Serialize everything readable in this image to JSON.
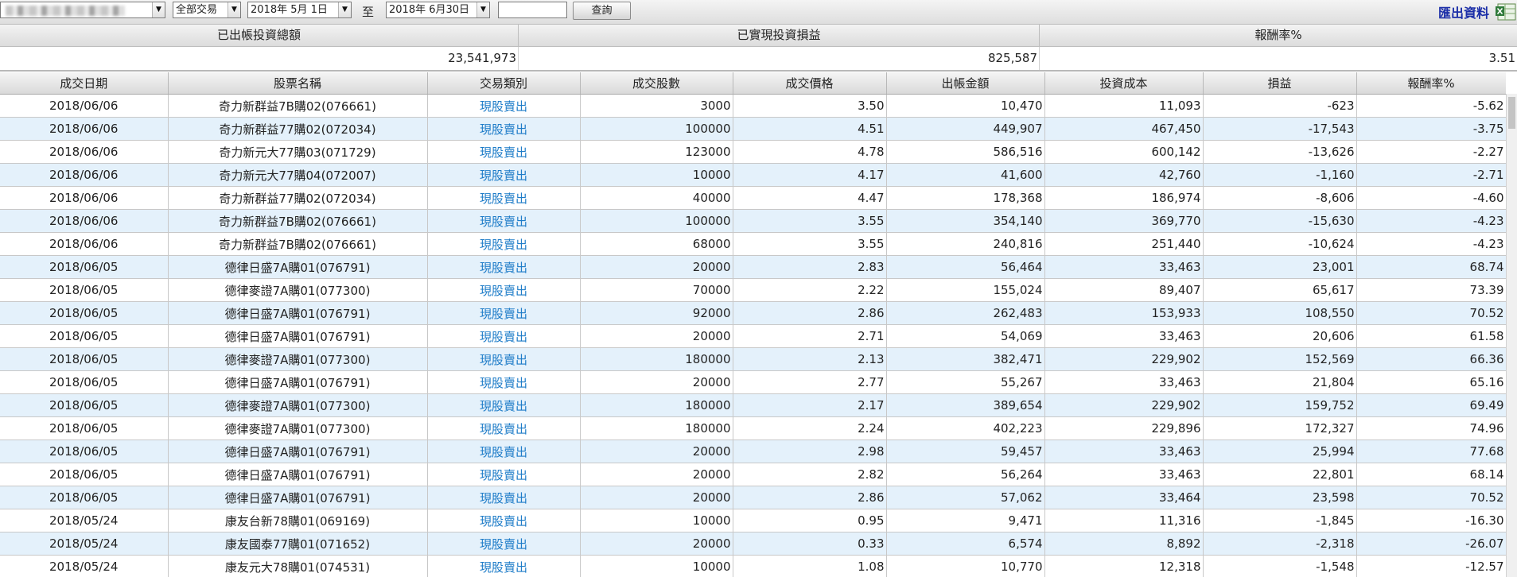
{
  "toolbar": {
    "account_select_value": "",
    "type_select_value": "全部交易",
    "date_from": "2018年 5月 1日",
    "to_label": "至",
    "date_to": "2018年 6月30日",
    "keyword_value": "",
    "query_label": "查詢",
    "export_label": "匯出資料",
    "export_icon": "excel-icon"
  },
  "summary": {
    "headers": [
      "已出帳投資總額",
      "已實現投資損益",
      "報酬率%"
    ],
    "values": [
      "23,541,973",
      "825,587",
      "3.51"
    ]
  },
  "table": {
    "columns": [
      "成交日期",
      "股票名稱",
      "交易類別",
      "成交股數",
      "成交價格",
      "出帳金額",
      "投資成本",
      "損益",
      "報酬率%"
    ],
    "rows": [
      [
        "2018/06/06",
        "奇力新群益7B購02(076661)",
        "現股賣出",
        "3000",
        "3.50",
        "10,470",
        "11,093",
        "-623",
        "-5.62"
      ],
      [
        "2018/06/06",
        "奇力新群益77購02(072034)",
        "現股賣出",
        "100000",
        "4.51",
        "449,907",
        "467,450",
        "-17,543",
        "-3.75"
      ],
      [
        "2018/06/06",
        "奇力新元大77購03(071729)",
        "現股賣出",
        "123000",
        "4.78",
        "586,516",
        "600,142",
        "-13,626",
        "-2.27"
      ],
      [
        "2018/06/06",
        "奇力新元大77購04(072007)",
        "現股賣出",
        "10000",
        "4.17",
        "41,600",
        "42,760",
        "-1,160",
        "-2.71"
      ],
      [
        "2018/06/06",
        "奇力新群益77購02(072034)",
        "現股賣出",
        "40000",
        "4.47",
        "178,368",
        "186,974",
        "-8,606",
        "-4.60"
      ],
      [
        "2018/06/06",
        "奇力新群益7B購02(076661)",
        "現股賣出",
        "100000",
        "3.55",
        "354,140",
        "369,770",
        "-15,630",
        "-4.23"
      ],
      [
        "2018/06/06",
        "奇力新群益7B購02(076661)",
        "現股賣出",
        "68000",
        "3.55",
        "240,816",
        "251,440",
        "-10,624",
        "-4.23"
      ],
      [
        "2018/06/05",
        "德律日盛7A購01(076791)",
        "現股賣出",
        "20000",
        "2.83",
        "56,464",
        "33,463",
        "23,001",
        "68.74"
      ],
      [
        "2018/06/05",
        "德律麥證7A購01(077300)",
        "現股賣出",
        "70000",
        "2.22",
        "155,024",
        "89,407",
        "65,617",
        "73.39"
      ],
      [
        "2018/06/05",
        "德律日盛7A購01(076791)",
        "現股賣出",
        "92000",
        "2.86",
        "262,483",
        "153,933",
        "108,550",
        "70.52"
      ],
      [
        "2018/06/05",
        "德律日盛7A購01(076791)",
        "現股賣出",
        "20000",
        "2.71",
        "54,069",
        "33,463",
        "20,606",
        "61.58"
      ],
      [
        "2018/06/05",
        "德律麥證7A購01(077300)",
        "現股賣出",
        "180000",
        "2.13",
        "382,471",
        "229,902",
        "152,569",
        "66.36"
      ],
      [
        "2018/06/05",
        "德律日盛7A購01(076791)",
        "現股賣出",
        "20000",
        "2.77",
        "55,267",
        "33,463",
        "21,804",
        "65.16"
      ],
      [
        "2018/06/05",
        "德律麥證7A購01(077300)",
        "現股賣出",
        "180000",
        "2.17",
        "389,654",
        "229,902",
        "159,752",
        "69.49"
      ],
      [
        "2018/06/05",
        "德律麥證7A購01(077300)",
        "現股賣出",
        "180000",
        "2.24",
        "402,223",
        "229,896",
        "172,327",
        "74.96"
      ],
      [
        "2018/06/05",
        "德律日盛7A購01(076791)",
        "現股賣出",
        "20000",
        "2.98",
        "59,457",
        "33,463",
        "25,994",
        "77.68"
      ],
      [
        "2018/06/05",
        "德律日盛7A購01(076791)",
        "現股賣出",
        "20000",
        "2.82",
        "56,264",
        "33,463",
        "22,801",
        "68.14"
      ],
      [
        "2018/06/05",
        "德律日盛7A購01(076791)",
        "現股賣出",
        "20000",
        "2.86",
        "57,062",
        "33,464",
        "23,598",
        "70.52"
      ],
      [
        "2018/05/24",
        "康友台新78購01(069169)",
        "現股賣出",
        "10000",
        "0.95",
        "9,471",
        "11,316",
        "-1,845",
        "-16.30"
      ],
      [
        "2018/05/24",
        "康友國泰77購01(071652)",
        "現股賣出",
        "20000",
        "0.33",
        "6,574",
        "8,892",
        "-2,318",
        "-26.07"
      ],
      [
        "2018/05/24",
        "康友元大78購01(074531)",
        "現股賣出",
        "10000",
        "1.08",
        "10,770",
        "12,318",
        "-1,548",
        "-12.57"
      ]
    ]
  }
}
